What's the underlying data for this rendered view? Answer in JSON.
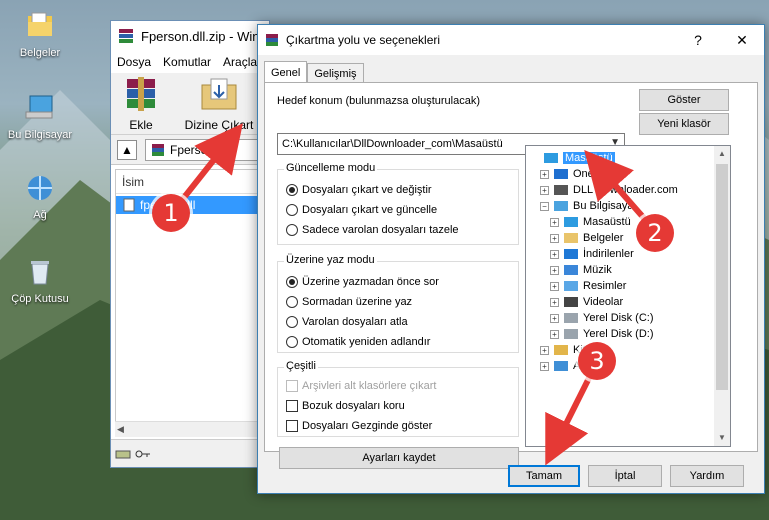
{
  "desktop": {
    "icons": [
      {
        "label": "Belgeler",
        "icon": "documents-folder-icon"
      },
      {
        "label": "Bu Bilgisayar",
        "icon": "computer-icon"
      },
      {
        "label": "Ağ",
        "icon": "network-icon"
      },
      {
        "label": "Çöp Kutusu",
        "icon": "recycle-bin-icon"
      }
    ]
  },
  "winrar": {
    "title": "Fperson.dll.zip - Win",
    "menu": [
      "Dosya",
      "Komutlar",
      "Araçla"
    ],
    "toolbar": {
      "add_label": "Ekle",
      "extract_label": "Dizine Çıkart"
    },
    "path": "Fperson.dll",
    "column_name": "İsim",
    "file_name": "fperson.dll",
    "scroll_left": "◀"
  },
  "dialog": {
    "title": "Çıkartma yolu ve seçenekleri",
    "help_button": "?",
    "close_button": "✕",
    "tabs": [
      "Genel",
      "Gelişmiş"
    ],
    "destination_label": "Hedef konum (bulunmazsa oluşturulacak)",
    "destination_value": "C:\\Kullanıcılar\\DllDownloader_com\\Masaüstü",
    "show_button": "Göster",
    "new_folder_button": "Yeni klasör",
    "update_mode": {
      "title": "Güncelleme modu",
      "options": [
        "Dosyaları çıkart ve değiştir",
        "Dosyaları çıkart ve güncelle",
        "Sadece varolan dosyaları tazele"
      ],
      "selected": 0
    },
    "overwrite_mode": {
      "title": "Üzerine yaz modu",
      "options": [
        "Üzerine yazmadan önce sor",
        "Sormadan üzerine yaz",
        "Varolan dosyaları atla",
        "Otomatik yeniden adlandır"
      ],
      "selected": 0
    },
    "misc": {
      "title": "Çeşitli",
      "options": [
        "Arşivleri alt klasörlere çıkart",
        "Bozuk dosyaları koru",
        "Dosyaları Gezginde göster"
      ],
      "disabled": [
        true,
        false,
        false
      ]
    },
    "save_settings_button": "Ayarları kaydet",
    "tree": [
      {
        "label": "Masaüstü",
        "level": 0,
        "expander": "",
        "icon": "desktop-icon",
        "selected": true
      },
      {
        "label": "OneD",
        "level": 1,
        "expander": "+",
        "icon": "onedrive-icon",
        "selected": false
      },
      {
        "label": "DLL Downloader.com",
        "level": 1,
        "expander": "+",
        "icon": "user-icon",
        "selected": false
      },
      {
        "label": "Bu Bilgisaya",
        "level": 1,
        "expander": "−",
        "icon": "computer-icon",
        "selected": false
      },
      {
        "label": "Masaüstü",
        "level": 2,
        "expander": "+",
        "icon": "desktop-icon",
        "selected": false
      },
      {
        "label": "Belgeler",
        "level": 2,
        "expander": "+",
        "icon": "documents-icon",
        "selected": false
      },
      {
        "label": "İndirilenler",
        "level": 2,
        "expander": "+",
        "icon": "downloads-icon",
        "selected": false
      },
      {
        "label": "Müzik",
        "level": 2,
        "expander": "+",
        "icon": "music-icon",
        "selected": false
      },
      {
        "label": "Resimler",
        "level": 2,
        "expander": "+",
        "icon": "pictures-icon",
        "selected": false
      },
      {
        "label": "Videolar",
        "level": 2,
        "expander": "+",
        "icon": "videos-icon",
        "selected": false
      },
      {
        "label": "Yerel Disk (C:)",
        "level": 2,
        "expander": "+",
        "icon": "disk-icon",
        "selected": false
      },
      {
        "label": "Yerel Disk (D:)",
        "level": 2,
        "expander": "+",
        "icon": "disk-icon",
        "selected": false
      },
      {
        "label": "Kitap",
        "level": 1,
        "expander": "+",
        "icon": "library-icon",
        "selected": false
      },
      {
        "label": "Ağ",
        "level": 1,
        "expander": "+",
        "icon": "network-icon",
        "selected": false
      }
    ],
    "ok_button": "Tamam",
    "cancel_button": "İptal",
    "help_btn": "Yardım"
  },
  "callouts": [
    "1",
    "2",
    "3"
  ],
  "colors": {
    "callout": "#e53935",
    "selection": "#3399ff",
    "accent": "#0078d7"
  }
}
